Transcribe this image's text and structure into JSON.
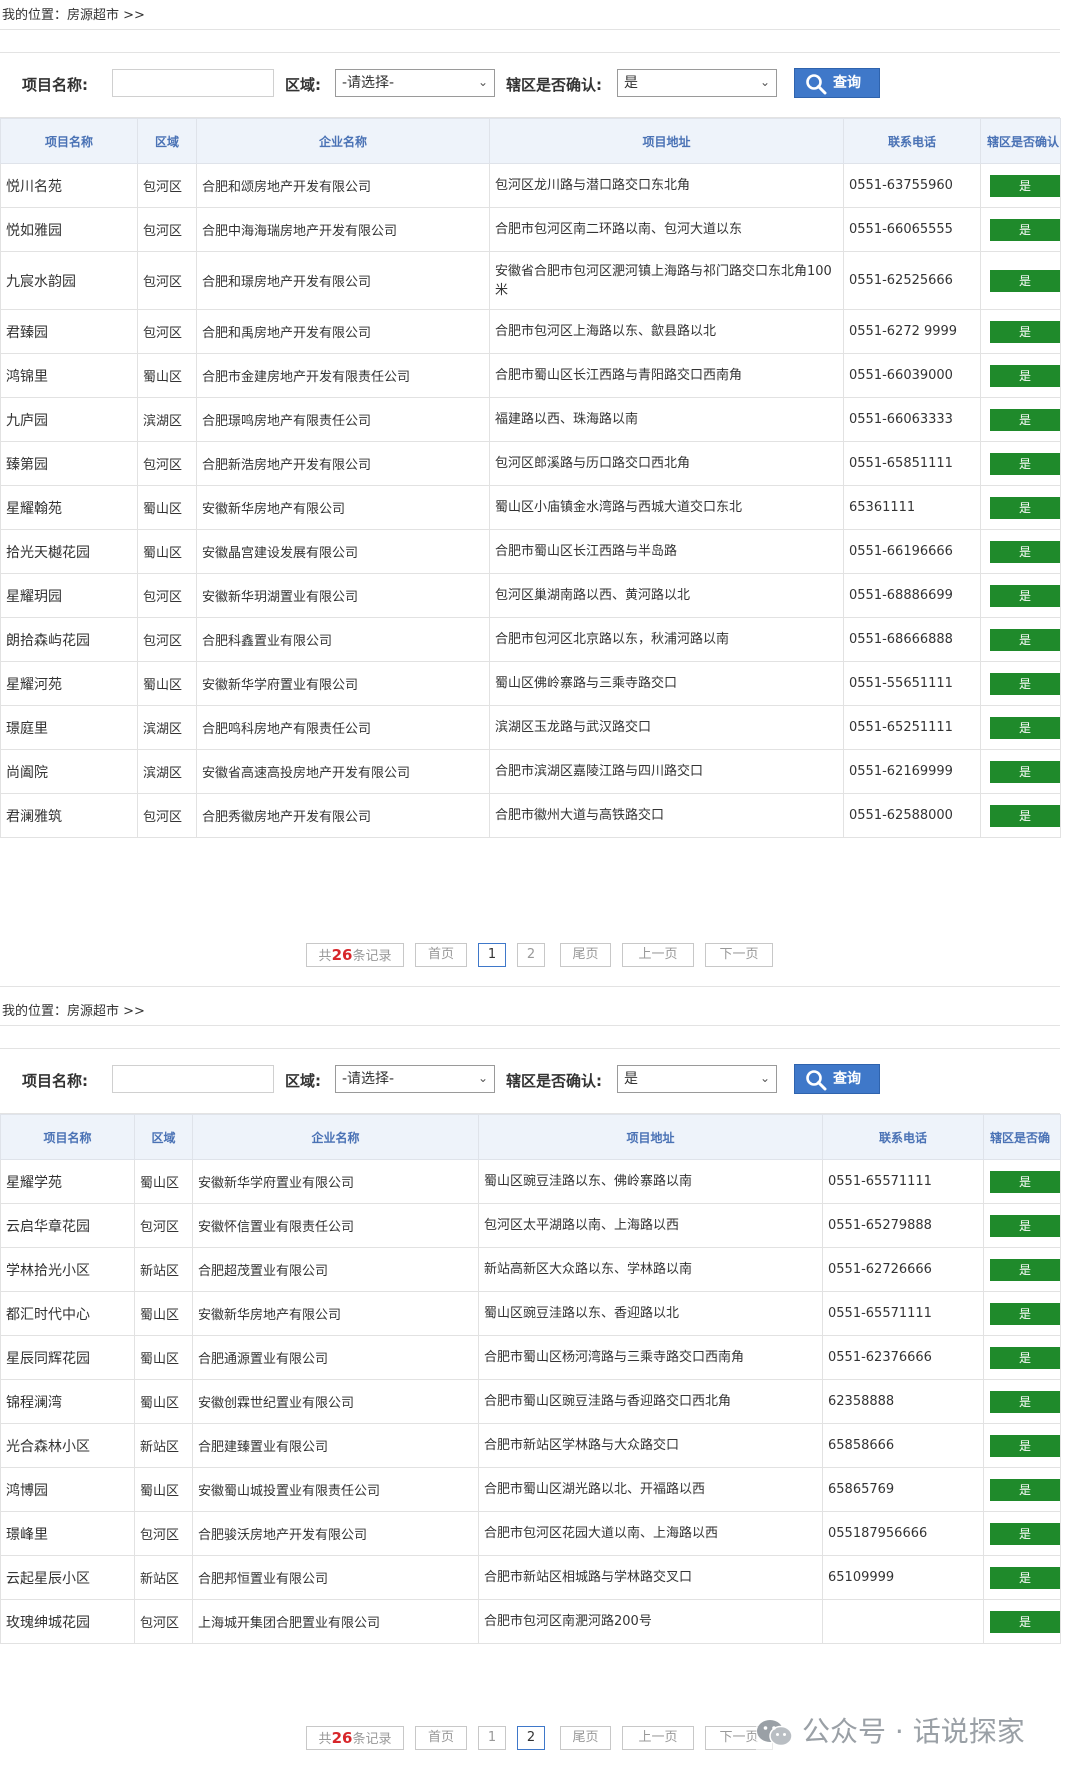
{
  "sections": [
    {
      "breadcrumb": "我的位置：房源超市 >>",
      "form": {
        "name_label": "项目名称:",
        "name_value": "",
        "area_label": "区域:",
        "area_selected": "-请选择-",
        "confirm_label": "辖区是否确认:",
        "confirm_selected": "是",
        "query_label": "查询"
      },
      "columns": [
        "项目名称",
        "区域",
        "企业名称",
        "项目地址",
        "联系电话",
        "辖区是否确认"
      ],
      "rows": [
        {
          "name": "悦川名苑",
          "area": "包河区",
          "company": "合肥和颂房地产开发有限公司",
          "address": "包河区龙川路与潜口路交口东北角",
          "phone": "0551-63755960",
          "status": "是"
        },
        {
          "name": "悦如雅园",
          "area": "包河区",
          "company": "合肥中海海瑞房地产开发有限公司",
          "address": "合肥市包河区南二环路以南、包河大道以东",
          "phone": "0551-66065555",
          "status": "是"
        },
        {
          "name": "九宸水韵园",
          "area": "包河区",
          "company": "合肥和璟房地产开发有限公司",
          "address": "安徽省合肥市包河区淝河镇上海路与祁门路交口东北角100米",
          "phone": "0551-62525666",
          "status": "是"
        },
        {
          "name": "君臻园",
          "area": "包河区",
          "company": "合肥和禹房地产开发有限公司",
          "address": "合肥市包河区上海路以东、歙县路以北",
          "phone": "0551-6272 9999",
          "status": "是"
        },
        {
          "name": "鸿锦里",
          "area": "蜀山区",
          "company": "合肥市金建房地产开发有限责任公司",
          "address": "合肥市蜀山区长江西路与青阳路交口西南角",
          "phone": "0551-66039000",
          "status": "是"
        },
        {
          "name": "九庐园",
          "area": "滨湖区",
          "company": "合肥璟鸣房地产有限责任公司",
          "address": "福建路以西、珠海路以南",
          "phone": "0551-66063333",
          "status": "是"
        },
        {
          "name": "臻第园",
          "area": "包河区",
          "company": "合肥新浩房地产开发有限公司",
          "address": "包河区郎溪路与历口路交口西北角",
          "phone": "0551-65851111",
          "status": "是"
        },
        {
          "name": "星耀翰苑",
          "area": "蜀山区",
          "company": "安徽新华房地产有限公司",
          "address": "蜀山区小庙镇金水湾路与西城大道交口东北",
          "phone": "65361111",
          "status": "是"
        },
        {
          "name": "拾光天樾花园",
          "area": "蜀山区",
          "company": "安徽晶宫建设发展有限公司",
          "address": "合肥市蜀山区长江西路与半岛路",
          "phone": "0551-66196666",
          "status": "是"
        },
        {
          "name": "星耀玥园",
          "area": "包河区",
          "company": "安徽新华玥湖置业有限公司",
          "address": "包河区巢湖南路以西、黄河路以北",
          "phone": "0551-68886699",
          "status": "是"
        },
        {
          "name": "朗拾森屿花园",
          "area": "包河区",
          "company": "合肥科鑫置业有限公司",
          "address": "合肥市包河区北京路以东，秋浦河路以南",
          "phone": "0551-68666888",
          "status": "是"
        },
        {
          "name": "星耀河苑",
          "area": "蜀山区",
          "company": "安徽新华学府置业有限公司",
          "address": "蜀山区佛岭寨路与三乘寺路交口",
          "phone": "0551-55651111",
          "status": "是"
        },
        {
          "name": "璟庭里",
          "area": "滨湖区",
          "company": "合肥鸣科房地产有限责任公司",
          "address": "滨湖区玉龙路与武汉路交口",
          "phone": "0551-65251111",
          "status": "是"
        },
        {
          "name": "尚阖院",
          "area": "滨湖区",
          "company": "安徽省高速高投房地产开发有限公司",
          "address": "合肥市滨湖区嘉陵江路与四川路交口",
          "phone": "0551-62169999",
          "status": "是"
        },
        {
          "name": "君澜雅筑",
          "area": "包河区",
          "company": "合肥秀徽房地产开发有限公司",
          "address": "合肥市徽州大道与高铁路交口",
          "phone": "0551-62588000",
          "status": "是"
        }
      ],
      "pager": {
        "total_prefix": "共",
        "total": "26",
        "total_suffix": "条记录",
        "first": "首页",
        "pages": [
          "1",
          "2"
        ],
        "current": "1",
        "last": "尾页",
        "prev": "上一页",
        "next": "下一页"
      }
    },
    {
      "breadcrumb": "我的位置：房源超市 >>",
      "form": {
        "name_label": "项目名称:",
        "name_value": "",
        "area_label": "区域:",
        "area_selected": "-请选择-",
        "confirm_label": "辖区是否确认:",
        "confirm_selected": "是",
        "query_label": "查询"
      },
      "columns": [
        "项目名称",
        "区域",
        "企业名称",
        "项目地址",
        "联系电话",
        "辖区是否确"
      ],
      "rows": [
        {
          "name": "星耀学苑",
          "area": "蜀山区",
          "company": "安徽新华学府置业有限公司",
          "address": "蜀山区豌豆洼路以东、佛岭寨路以南",
          "phone": "0551-65571111",
          "status": "是"
        },
        {
          "name": "云启华章花园",
          "area": "包河区",
          "company": "安徽怀信置业有限责任公司",
          "address": "包河区太平湖路以南、上海路以西",
          "phone": "0551-65279888",
          "status": "是"
        },
        {
          "name": "学林拾光小区",
          "area": "新站区",
          "company": "合肥超茂置业有限公司",
          "address": "新站高新区大众路以东、学林路以南",
          "phone": "0551-62726666",
          "status": "是"
        },
        {
          "name": "都汇时代中心",
          "area": "蜀山区",
          "company": "安徽新华房地产有限公司",
          "address": "蜀山区豌豆洼路以东、香迎路以北",
          "phone": "0551-65571111",
          "status": "是"
        },
        {
          "name": "星辰同辉花园",
          "area": "蜀山区",
          "company": "合肥通源置业有限公司",
          "address": "合肥市蜀山区杨河湾路与三乘寺路交口西南角",
          "phone": "0551-62376666",
          "status": "是"
        },
        {
          "name": "锦程澜湾",
          "area": "蜀山区",
          "company": "安徽创霖世纪置业有限公司",
          "address": "合肥市蜀山区豌豆洼路与香迎路交口西北角",
          "phone": "62358888",
          "status": "是"
        },
        {
          "name": "光合森林小区",
          "area": "新站区",
          "company": "合肥建臻置业有限公司",
          "address": "合肥市新站区学林路与大众路交口",
          "phone": "65858666",
          "status": "是"
        },
        {
          "name": "鸿博园",
          "area": "蜀山区",
          "company": "安徽蜀山城投置业有限责任公司",
          "address": "合肥市蜀山区湖光路以北、开福路以西",
          "phone": "65865769",
          "status": "是"
        },
        {
          "name": "璟峰里",
          "area": "包河区",
          "company": "合肥骏沃房地产开发有限公司",
          "address": "合肥市包河区花园大道以南、上海路以西",
          "phone": "055187956666",
          "status": "是"
        },
        {
          "name": "云起星辰小区",
          "area": "新站区",
          "company": "合肥邦恒置业有限公司",
          "address": "合肥市新站区相城路与学林路交叉口",
          "phone": "65109999",
          "status": "是"
        },
        {
          "name": "玫瑰绅城花园",
          "area": "包河区",
          "company": "上海城开集团合肥置业有限公司",
          "address": "合肥市包河区南淝河路200号",
          "phone": "",
          "status": "是"
        }
      ],
      "pager": {
        "total_prefix": "共",
        "total": "26",
        "total_suffix": "条记录",
        "first": "首页",
        "pages": [
          "1",
          "2"
        ],
        "current": "2",
        "last": "尾页",
        "prev": "上一页",
        "next": "下一页"
      }
    }
  ],
  "watermark": "公众号 · 话说探家",
  "colors": {
    "accent": "#3f78c9",
    "header_text": "#4a72b5",
    "header_bg": "#eef3fa",
    "badge": "#1f8a2b",
    "total_count": "#d7262a"
  }
}
